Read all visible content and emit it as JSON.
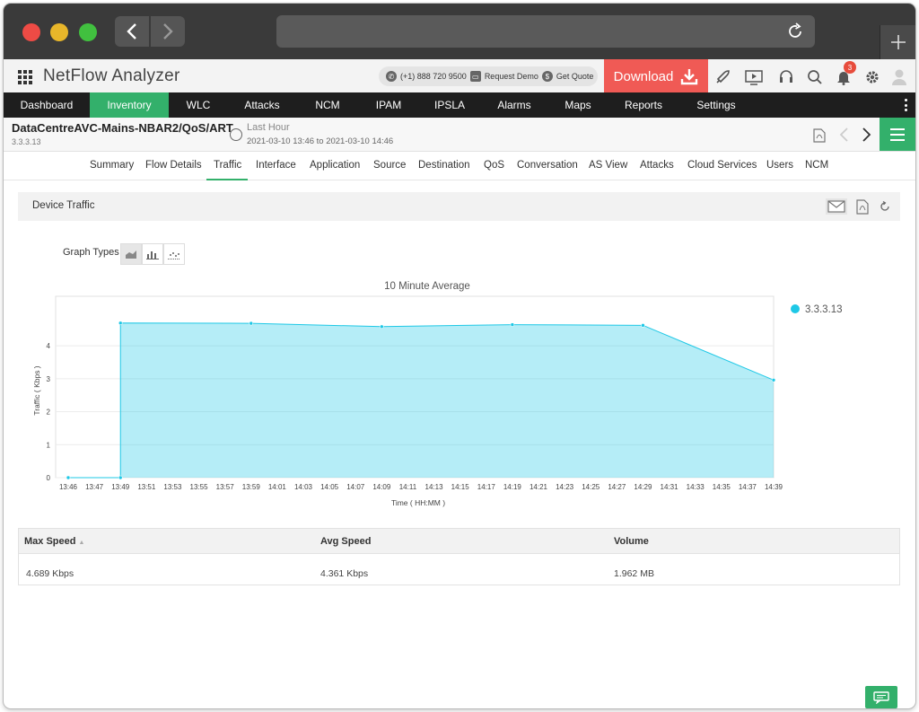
{
  "app": {
    "title": "NetFlow Analyzer",
    "phone": "(+1) 888 720 9500",
    "request_demo": "Request Demo",
    "get_quote": "Get Quote",
    "download_label": "Download",
    "notification_count": "3"
  },
  "mainnav": {
    "items": [
      "Dashboard",
      "Inventory",
      "WLC",
      "Attacks",
      "NCM",
      "IPAM",
      "IPSLA",
      "Alarms",
      "Maps",
      "Reports",
      "Settings"
    ],
    "active": "Inventory"
  },
  "device": {
    "name": "DataCentreAVC-Mains-NBAR2/QoS/ART",
    "ip": "3.3.3.13",
    "time_label": "Last Hour",
    "time_range": "2021-03-10 13:46 to 2021-03-10 14:46"
  },
  "tabs": {
    "items": [
      "Summary",
      "Flow Details",
      "Traffic",
      "Interface",
      "Application",
      "Source",
      "Destination",
      "QoS",
      "Conversation",
      "AS View",
      "Attacks",
      "Cloud Services",
      "Users",
      "NCM"
    ],
    "active": "Traffic"
  },
  "panel": {
    "title": "Device Traffic",
    "graph_types_label": "Graph Types"
  },
  "chart_data": {
    "type": "area",
    "title": "10 Minute Average",
    "xlabel": "Time ( HH:MM )",
    "ylabel": "Traffic ( Kbps )",
    "x_ticks": [
      "13:46",
      "13:47",
      "13:49",
      "13:51",
      "13:53",
      "13:55",
      "13:57",
      "13:59",
      "14:01",
      "14:03",
      "14:05",
      "14:07",
      "14:09",
      "14:11",
      "14:13",
      "14:15",
      "14:17",
      "14:19",
      "14:21",
      "14:23",
      "14:25",
      "14:27",
      "14:29",
      "14:31",
      "14:33",
      "14:35",
      "14:37",
      "14:39"
    ],
    "y_ticks": [
      0,
      1,
      2,
      3,
      4
    ],
    "ylim": [
      0,
      5.5
    ],
    "series": [
      {
        "name": "3.3.3.13",
        "color": "#1ec8e6",
        "points": [
          {
            "x": "13:46",
            "y": 0
          },
          {
            "x": "13:49",
            "y": 0
          },
          {
            "x": "13:49",
            "y": 4.689
          },
          {
            "x": "13:59",
            "y": 4.68
          },
          {
            "x": "14:09",
            "y": 4.58
          },
          {
            "x": "14:19",
            "y": 4.64
          },
          {
            "x": "14:29",
            "y": 4.62
          },
          {
            "x": "14:39",
            "y": 2.96
          }
        ],
        "markers": [
          {
            "x": "13:46",
            "y": 0
          },
          {
            "x": "13:49",
            "y": 0
          },
          {
            "x": "13:49",
            "y": 4.689
          },
          {
            "x": "13:59",
            "y": 4.68
          },
          {
            "x": "14:09",
            "y": 4.58
          },
          {
            "x": "14:19",
            "y": 4.64
          },
          {
            "x": "14:29",
            "y": 4.62
          },
          {
            "x": "14:39",
            "y": 2.96
          }
        ]
      }
    ],
    "legend_position": "top-right",
    "grid": true
  },
  "stats": {
    "headers": [
      "Max Speed",
      "Avg Speed",
      "Volume"
    ],
    "values": [
      "4.689 Kbps",
      "4.361 Kbps",
      "1.962 MB"
    ]
  }
}
